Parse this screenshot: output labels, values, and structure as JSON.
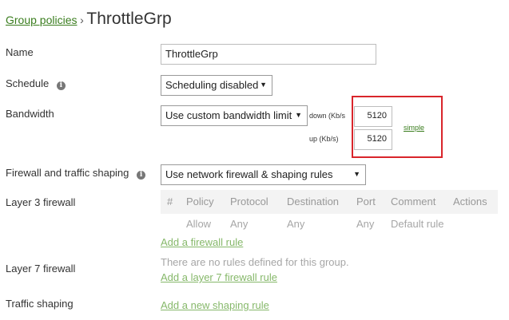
{
  "breadcrumb": {
    "parent": "Group policies",
    "separator": "›",
    "current": "ThrottleGrp"
  },
  "fields": {
    "name": {
      "label": "Name",
      "value": "ThrottleGrp"
    },
    "schedule": {
      "label": "Schedule",
      "value": "Scheduling disabled"
    },
    "bandwidth": {
      "label": "Bandwidth",
      "value": "Use custom bandwidth limit",
      "down_label": "down (Kb/s",
      "down_value": "5120",
      "up_label": "up (Kb/s)",
      "up_value": "5120",
      "mode_link": "simple"
    },
    "firewall_shaping": {
      "label": "Firewall and traffic shaping",
      "value": "Use network firewall & shaping rules"
    }
  },
  "layer3": {
    "label": "Layer 3 firewall",
    "columns": [
      "#",
      "Policy",
      "Protocol",
      "Destination",
      "Port",
      "Comment",
      "Actions"
    ],
    "rows": [
      {
        "num": "",
        "policy": "Allow",
        "protocol": "Any",
        "destination": "Any",
        "port": "Any",
        "comment": "Default rule"
      }
    ],
    "add_link": "Add a firewall rule"
  },
  "layer7": {
    "label": "Layer 7 firewall",
    "empty_text": "There are no rules defined for this group.",
    "add_link": "Add a layer 7 firewall rule"
  },
  "traffic_shaping": {
    "label": "Traffic shaping",
    "add_link": "Add a new shaping rule"
  },
  "icons": {
    "info": "info-icon",
    "dropdown": "chevron-down-icon"
  },
  "colors": {
    "link_green": "#3a7d1e",
    "light_link_green": "#86b86a",
    "highlight_red": "#d9252b",
    "table_header_bg": "#f3f3f3"
  }
}
